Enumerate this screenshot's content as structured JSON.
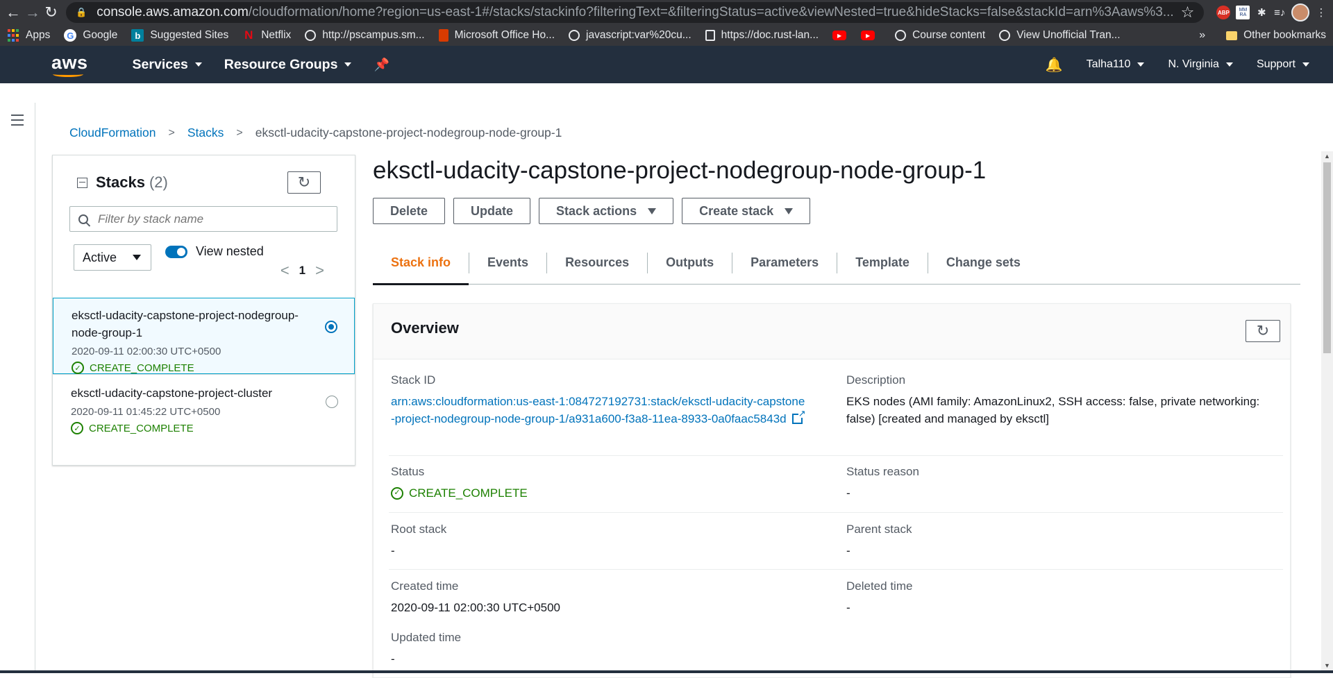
{
  "browser": {
    "url_host": "console.aws.amazon.com",
    "url_path": "/cloudformation/home?region=us-east-1#/stacks/stackinfo?filteringText=&filteringStatus=active&viewNested=true&hideStacks=false&stackId=arn%3Aaws%3...",
    "bookmarks": [
      {
        "label": "Apps",
        "icon": "apps-grid-icon"
      },
      {
        "label": "Google",
        "icon": "google-icon"
      },
      {
        "label": "Suggested Sites",
        "icon": "bing-icon"
      },
      {
        "label": "Netflix",
        "icon": "netflix-icon"
      },
      {
        "label": "http://pscampus.sm...",
        "icon": "globe-icon"
      },
      {
        "label": "Microsoft Office Ho...",
        "icon": "office-icon"
      },
      {
        "label": "javascript:var%20cu...",
        "icon": "globe-icon"
      },
      {
        "label": "https://doc.rust-lan...",
        "icon": "doc-icon"
      },
      {
        "label": "",
        "icon": "youtube-icon"
      },
      {
        "label": "",
        "icon": "youtube-icon"
      },
      {
        "label": "Course content",
        "icon": "globe-icon"
      },
      {
        "label": "View Unofficial Tran...",
        "icon": "globe-icon"
      }
    ],
    "more": "»",
    "other_bookmarks": "Other bookmarks"
  },
  "aws": {
    "logo": "aws",
    "services": "Services",
    "resource_groups": "Resource Groups",
    "user": "Talha110",
    "region": "N. Virginia",
    "support": "Support"
  },
  "breadcrumb": {
    "root": "CloudFormation",
    "stacks": "Stacks",
    "current": "eksctl-udacity-capstone-project-nodegroup-node-group-1"
  },
  "stacks_panel": {
    "title": "Stacks",
    "count": "(2)",
    "filter_placeholder": "Filter by stack name",
    "status_filter": "Active",
    "view_nested": "View nested",
    "page": "1",
    "items": [
      {
        "name": "eksctl-udacity-capstone-project-nodegroup-node-group-1",
        "time": "2020-09-11 02:00:30 UTC+0500",
        "status": "CREATE_COMPLETE"
      },
      {
        "name": "eksctl-udacity-capstone-project-cluster",
        "time": "2020-09-11 01:45:22 UTC+0500",
        "status": "CREATE_COMPLETE"
      }
    ]
  },
  "main": {
    "title": "eksctl-udacity-capstone-project-nodegroup-node-group-1",
    "actions": {
      "delete": "Delete",
      "update": "Update",
      "stack_actions": "Stack actions",
      "create_stack": "Create stack"
    },
    "tabs": [
      "Stack info",
      "Events",
      "Resources",
      "Outputs",
      "Parameters",
      "Template",
      "Change sets"
    ],
    "overview": {
      "heading": "Overview",
      "stack_id_label": "Stack ID",
      "stack_id": "arn:aws:cloudformation:us-east-1:084727192731:stack/eksctl-udacity-capstone-project-nodegroup-node-group-1/a931a600-f3a8-11ea-8933-0a0faac5843d",
      "description_label": "Description",
      "description": "EKS nodes (AMI family: AmazonLinux2, SSH access: false, private networking: false) [created and managed by eksctl]",
      "status_label": "Status",
      "status": "CREATE_COMPLETE",
      "status_reason_label": "Status reason",
      "status_reason": "-",
      "root_stack_label": "Root stack",
      "root_stack": "-",
      "parent_stack_label": "Parent stack",
      "parent_stack": "-",
      "created_label": "Created time",
      "created": "2020-09-11 02:00:30 UTC+0500",
      "deleted_label": "Deleted time",
      "deleted": "-",
      "updated_label": "Updated time",
      "updated": "-"
    }
  },
  "colors": {
    "aws_nav": "#232f3e",
    "link": "#0073bb",
    "success": "#1d8102",
    "active_tab": "#ec7211"
  }
}
